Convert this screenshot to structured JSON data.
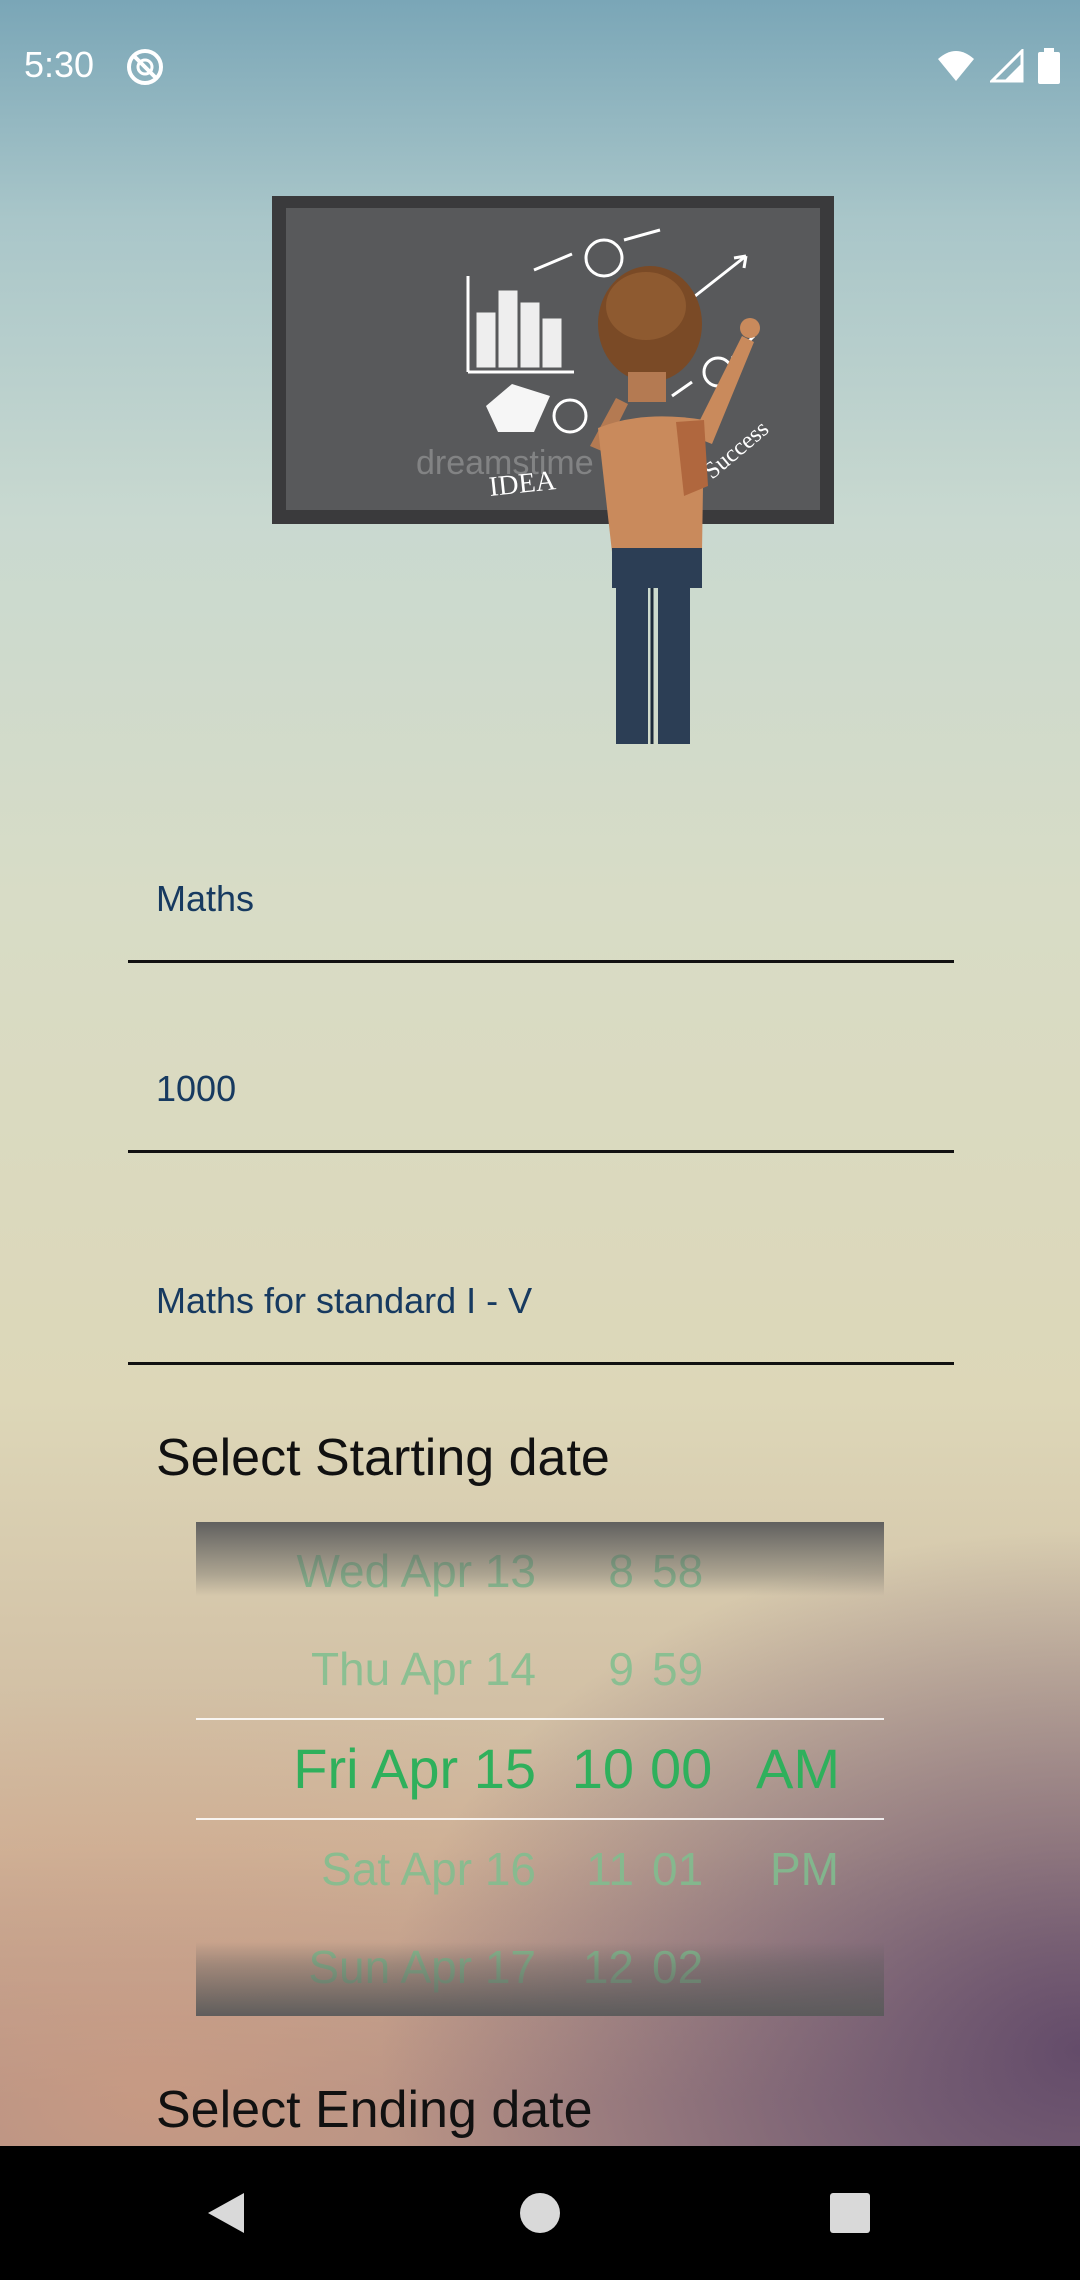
{
  "status_bar": {
    "time": "5:30",
    "icons": [
      "do-not-disturb-icon",
      "wifi-icon",
      "cell-signal-icon",
      "battery-icon"
    ]
  },
  "illustration": {
    "board_texts": [
      "IDEA",
      "Success"
    ],
    "watermark": "dreamstime"
  },
  "form": {
    "subject_value": "Maths",
    "fee_value": "1000",
    "description_value": "Maths for standard I - V"
  },
  "start_date": {
    "label": "Select Starting date",
    "picker": {
      "rows": [
        {
          "date": "Wed Apr 13",
          "hour": "8",
          "minute": "58",
          "ampm": ""
        },
        {
          "date": "Thu Apr 14",
          "hour": "9",
          "minute": "59",
          "ampm": ""
        },
        {
          "date": "Fri Apr 15",
          "hour": "10",
          "minute": "00",
          "ampm": "AM"
        },
        {
          "date": "Sat Apr 16",
          "hour": "11",
          "minute": "01",
          "ampm": "PM"
        },
        {
          "date": "Sun Apr 17",
          "hour": "12",
          "minute": "02",
          "ampm": ""
        }
      ],
      "selected_index": 2
    }
  },
  "end_date": {
    "label": "Select Ending date"
  },
  "colors": {
    "selected_text": "#2fb05c",
    "dim_text": "#7fbf8f",
    "input_text": "#173a60"
  }
}
